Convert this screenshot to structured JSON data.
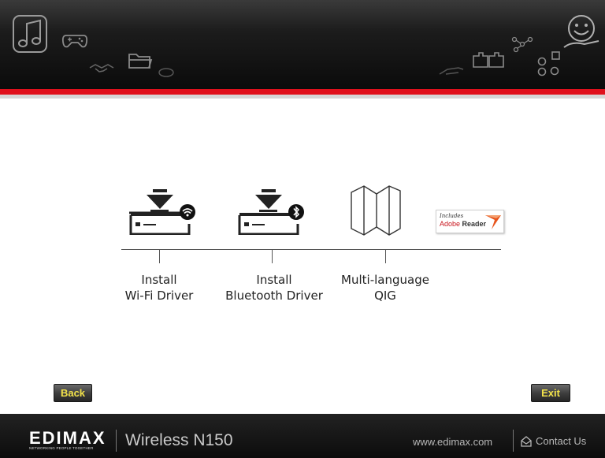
{
  "header": {
    "icons": [
      "music-notes-icon",
      "gamepad-icon",
      "handshake-icon",
      "folder-icon",
      "mouse-icon",
      "hand-icon",
      "puzzle-icon",
      "network-icon",
      "smiley-hand-icon"
    ]
  },
  "menu": {
    "items": [
      {
        "line1": "Install",
        "line2": "Wi-Fi Driver",
        "icon": "wifi-driver-download-icon"
      },
      {
        "line1": "Install",
        "line2": "Bluetooth Driver",
        "icon": "bluetooth-driver-download-icon"
      },
      {
        "line1": "Multi-language",
        "line2": "QIG",
        "icon": "folded-map-icon"
      }
    ],
    "adobe": {
      "includes": "Includes",
      "brand": "Adobe",
      "product": "Reader"
    }
  },
  "buttons": {
    "back": "Back",
    "exit": "Exit"
  },
  "footer": {
    "logo": "EDIMAX",
    "tagline": "NETWORKING PEOPLE TOGETHER",
    "product": "Wireless N150",
    "url": "www.edimax.com",
    "contact": "Contact Us"
  },
  "colors": {
    "accent_red": "#e0101c",
    "button_text": "#f2e24a",
    "footer_bg": "#111111"
  }
}
